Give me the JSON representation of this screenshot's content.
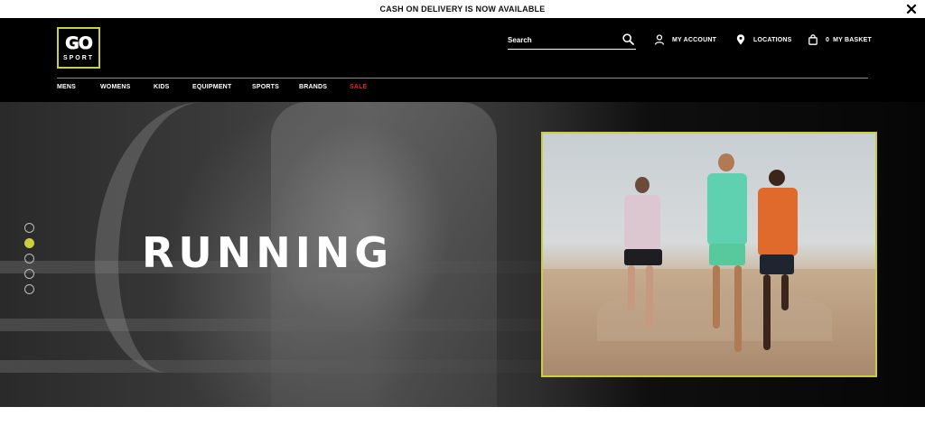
{
  "announcement": {
    "text": "CASH ON DELIVERY IS NOW AVAILABLE"
  },
  "brand": {
    "logo_top": "GO",
    "logo_bottom": "SPORT",
    "accent_color": "#c9cf3e"
  },
  "header": {
    "search_placeholder": "Search",
    "account_label": "MY ACCOUNT",
    "locations_label": "LOCATIONS",
    "basket_count": "0",
    "basket_label": "MY BASKET",
    "icons": {
      "search": "search-icon",
      "account": "user-icon",
      "locations": "map-pin-icon",
      "basket": "shopping-bag-icon"
    }
  },
  "nav": {
    "items": [
      {
        "label": "MENS"
      },
      {
        "label": "WOMENS"
      },
      {
        "label": "KIDS"
      },
      {
        "label": "EQUIPMENT"
      },
      {
        "label": "SPORTS"
      },
      {
        "label": "BRANDS"
      },
      {
        "label": "SALE",
        "color": "#e02424"
      }
    ]
  },
  "hero": {
    "title": "RUNNING",
    "slides_total": 5,
    "active_slide": 2
  }
}
